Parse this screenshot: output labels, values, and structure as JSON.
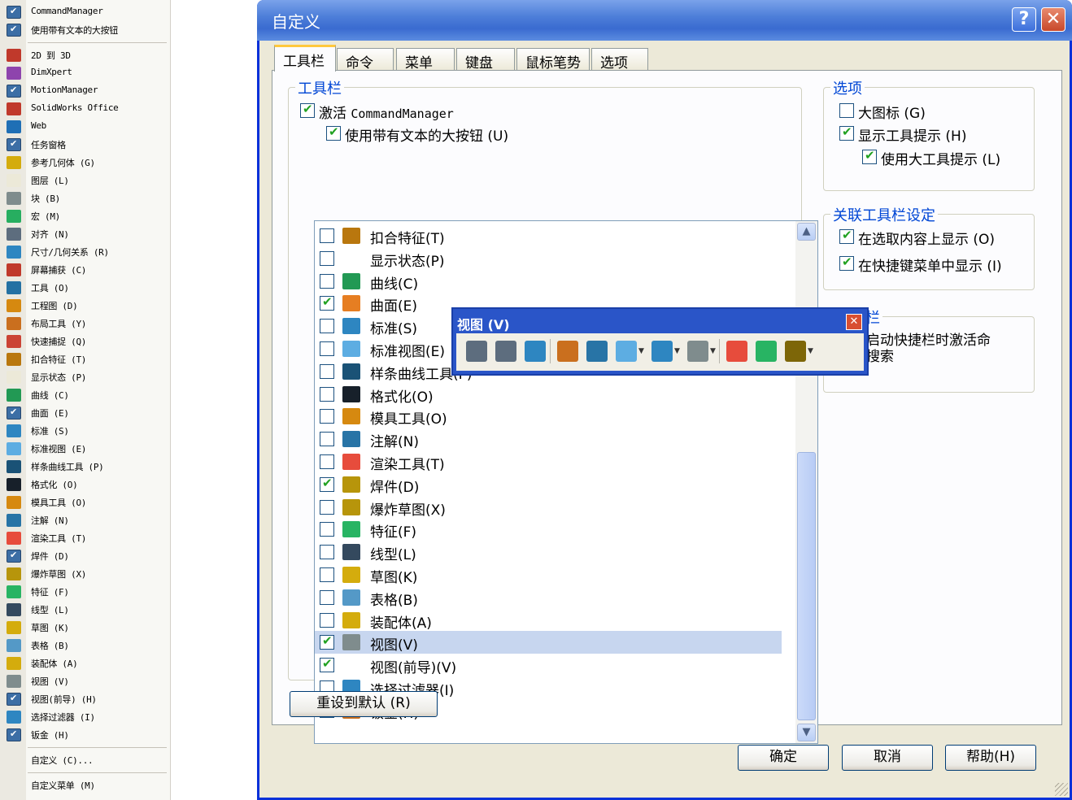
{
  "context_menu": {
    "items": [
      {
        "label": "CommandManager",
        "checked": true
      },
      {
        "label": "使用带有文本的大按钮",
        "checked": true
      },
      {
        "sep": true
      },
      {
        "label": "2D 到 3D",
        "icon": "2d-to-3d-icon",
        "color": "#c0392b"
      },
      {
        "label": "DimXpert",
        "icon": "dimxpert-icon",
        "color": "#8e44ad"
      },
      {
        "label": "MotionManager",
        "checked": true
      },
      {
        "label": "SolidWorks Office",
        "icon": "office-icon",
        "color": "#c0392b"
      },
      {
        "label": "Web",
        "icon": "web-icon",
        "color": "#1f6fb5"
      },
      {
        "label": "任务窗格",
        "checked": true
      },
      {
        "label": "参考几何体 (G)",
        "icon": "reference-geometry-icon",
        "color": "#d4ac0d"
      },
      {
        "label": "图层 (L)",
        "icon": "layer-icon",
        "color": "#ece9d8"
      },
      {
        "label": "块 (B)",
        "icon": "block-icon",
        "color": "#7f8c8d"
      },
      {
        "label": "宏 (M)",
        "icon": "macro-icon",
        "color": "#27ae60"
      },
      {
        "label": "对齐 (N)",
        "icon": "align-icon",
        "color": "#5d6d7e"
      },
      {
        "label": "尺寸/几何关系 (R)",
        "icon": "dimension-icon",
        "color": "#2e86c1"
      },
      {
        "label": "屏幕捕获 (C)",
        "icon": "screen-capture-icon",
        "color": "#c0392b"
      },
      {
        "label": "工具 (O)",
        "icon": "tools-icon",
        "color": "#2471a3"
      },
      {
        "label": "工程图 (D)",
        "icon": "drawing-icon",
        "color": "#d68910"
      },
      {
        "label": "布局工具 (Y)",
        "icon": "layout-tools-icon",
        "color": "#ca6f1e"
      },
      {
        "label": "快速捕捉 (Q)",
        "icon": "quick-snap-icon",
        "color": "#cb4335"
      },
      {
        "label": "扣合特征 (T)",
        "icon": "fastening-icon",
        "color": "#b9770e"
      },
      {
        "label": "显示状态 (P)",
        "icon": "display-state-icon",
        "color": "#ece9d8"
      },
      {
        "label": "曲线 (C)",
        "icon": "curve-icon",
        "color": "#229954"
      },
      {
        "label": "曲面 (E)",
        "checked": true
      },
      {
        "label": "标准 (S)",
        "icon": "standard-icon",
        "color": "#2e86c1"
      },
      {
        "label": "标准视图 (E)",
        "icon": "standard-view-icon",
        "color": "#5dade2"
      },
      {
        "label": "样条曲线工具 (P)",
        "icon": "spline-icon",
        "color": "#1a5276"
      },
      {
        "label": "格式化 (O)",
        "icon": "format-icon",
        "color": "#17202a"
      },
      {
        "label": "模具工具 (O)",
        "icon": "mold-tools-icon",
        "color": "#d68910"
      },
      {
        "label": "注解 (N)",
        "icon": "annotation-icon",
        "color": "#2874a6"
      },
      {
        "label": "渲染工具 (T)",
        "icon": "render-tools-icon",
        "color": "#e74c3c"
      },
      {
        "label": "焊件 (D)",
        "checked": true
      },
      {
        "label": "爆炸草图 (X)",
        "icon": "explode-sketch-icon",
        "color": "#b7950b"
      },
      {
        "label": "特征 (F)",
        "icon": "features-icon",
        "color": "#28b463"
      },
      {
        "label": "线型 (L)",
        "icon": "line-format-icon",
        "color": "#34495e"
      },
      {
        "label": "草图 (K)",
        "icon": "sketch-icon",
        "color": "#d4ac0d"
      },
      {
        "label": "表格 (B)",
        "icon": "table-icon",
        "color": "#5499c7"
      },
      {
        "label": "装配体 (A)",
        "icon": "assembly-icon",
        "color": "#d4ac0d"
      },
      {
        "label": "视图 (V)",
        "icon": "view-icon",
        "color": "#7f8c8d"
      },
      {
        "label": "视图(前导) (H)",
        "checked": true
      },
      {
        "label": "选择过滤器 (I)",
        "icon": "selection-filter-icon",
        "color": "#2e86c1"
      },
      {
        "label": "钣金 (H)",
        "checked": true
      },
      {
        "sep": true
      },
      {
        "label": "自定义 (C)..."
      },
      {
        "sep": true
      },
      {
        "label": "自定义菜单 (M)"
      }
    ]
  },
  "dialog": {
    "title": "自定义",
    "help": "?",
    "close": "✕",
    "tabs": [
      "工具栏",
      "命令",
      "菜单",
      "键盘",
      "鼠标笔势",
      "选项"
    ],
    "toolbar_group": {
      "title": "工具栏",
      "activate_prefix": "激活 ",
      "activate_name": "CommandManager",
      "large_buttons": "使用带有文本的大按钮 (U)"
    },
    "toolbars": [
      {
        "label": "扣合特征(T)",
        "checked": false,
        "icon": "fastening-icon",
        "color": "#b9770e"
      },
      {
        "label": "显示状态(P)",
        "checked": false,
        "icon": "",
        "color": ""
      },
      {
        "label": "曲线(C)",
        "checked": false,
        "icon": "curve-icon",
        "color": "#229954"
      },
      {
        "label": "曲面(E)",
        "checked": true,
        "icon": "surface-icon",
        "color": "#e67e22"
      },
      {
        "label": "标准(S)",
        "checked": false,
        "icon": "standard-icon",
        "color": "#2e86c1"
      },
      {
        "label": "标准视图(E)",
        "checked": false,
        "icon": "standard-view-icon",
        "color": "#5dade2"
      },
      {
        "label": "样条曲线工具(P)",
        "checked": false,
        "icon": "spline-icon",
        "color": "#1a5276"
      },
      {
        "label": "格式化(O)",
        "checked": false,
        "icon": "format-icon",
        "color": "#17202a"
      },
      {
        "label": "模具工具(O)",
        "checked": false,
        "icon": "mold-tools-icon",
        "color": "#d68910"
      },
      {
        "label": "注解(N)",
        "checked": false,
        "icon": "annotation-icon",
        "color": "#2874a6"
      },
      {
        "label": "渲染工具(T)",
        "checked": false,
        "icon": "render-tools-icon",
        "color": "#e74c3c"
      },
      {
        "label": "焊件(D)",
        "checked": true,
        "icon": "weldments-icon",
        "color": "#b7950b"
      },
      {
        "label": "爆炸草图(X)",
        "checked": false,
        "icon": "explode-sketch-icon",
        "color": "#b7950b"
      },
      {
        "label": "特征(F)",
        "checked": false,
        "icon": "features-icon",
        "color": "#28b463"
      },
      {
        "label": "线型(L)",
        "checked": false,
        "icon": "line-format-icon",
        "color": "#34495e"
      },
      {
        "label": "草图(K)",
        "checked": false,
        "icon": "sketch-icon",
        "color": "#d4ac0d"
      },
      {
        "label": "表格(B)",
        "checked": false,
        "icon": "table-icon",
        "color": "#5499c7"
      },
      {
        "label": "装配体(A)",
        "checked": false,
        "icon": "assembly-icon",
        "color": "#d4ac0d"
      },
      {
        "label": "视图(V)",
        "checked": true,
        "icon": "view-icon",
        "color": "#7f8c8d",
        "selected": true
      },
      {
        "label": "视图(前导)(V)",
        "checked": true,
        "icon": "",
        "color": ""
      },
      {
        "label": "选择过滤器(I)",
        "checked": false,
        "icon": "selection-filter-icon",
        "color": "#2e86c1"
      },
      {
        "label": "钣金(H)",
        "checked": true,
        "icon": "sheet-metal-icon",
        "color": "#ca6f1e"
      }
    ],
    "options_group": {
      "title": "选项",
      "large_icons": "大图标 (G)",
      "show_tooltips": "显示工具提示 (H)",
      "large_tooltips": "使用大工具提示 (L)"
    },
    "context_group": {
      "title": "关联工具栏设定",
      "show_on_selection": "在选取内容上显示 (O)",
      "show_in_shortcut": "在快捷键菜单中显示 (I)"
    },
    "shortcut_group": {
      "title": "栏",
      "text_line1": "启动快捷栏时激活命",
      "text_line2": "搜索"
    },
    "reset_button": "重设到默认 (R)",
    "ok_button": "确定",
    "cancel_button": "取消",
    "help_button": "帮助(H)"
  },
  "floating_toolbar": {
    "title": "视图 (V)",
    "close": "✕",
    "icons": [
      {
        "name": "zoom-to-fit-icon",
        "color": "#5d6d7e"
      },
      {
        "name": "zoom-to-area-icon",
        "color": "#5d6d7e"
      },
      {
        "name": "previous-view-icon",
        "color": "#2e86c1"
      },
      {
        "name": "section-view-icon",
        "color": "#ca6f1e"
      },
      {
        "name": "view-orientation-icon",
        "color": "#2874a6"
      },
      {
        "name": "standard-views-icon",
        "color": "#5dade2",
        "dropdown": true
      },
      {
        "name": "display-style-icon",
        "color": "#2e86c1",
        "dropdown": true
      },
      {
        "name": "hide-show-items-icon",
        "color": "#7f8c8d",
        "dropdown": true
      },
      {
        "name": "edit-appearance-icon",
        "color": "#e74c3c"
      },
      {
        "name": "apply-scene-icon",
        "color": "#28b463"
      },
      {
        "name": "view-settings-icon",
        "color": "#7d6608",
        "dropdown": true
      }
    ]
  }
}
